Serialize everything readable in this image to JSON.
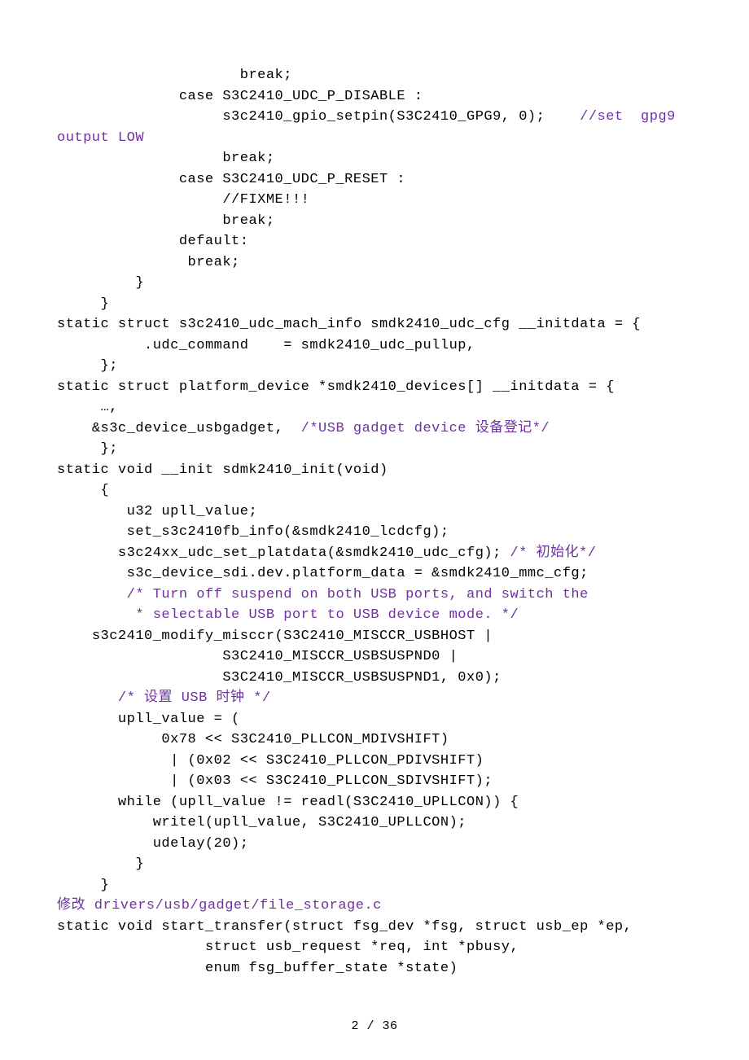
{
  "lines": [
    {
      "indent": "                     ",
      "spans": [
        {
          "t": "break;",
          "c": "black"
        }
      ]
    },
    {
      "indent": "              ",
      "spans": [
        {
          "t": "case S3C2410_UDC_P_DISABLE :",
          "c": "black"
        }
      ]
    },
    {
      "indent": "                   ",
      "spans": [
        {
          "t": "s3c2410_gpio_setpin(S3C2410_GPG9, 0);    ",
          "c": "black"
        },
        {
          "t": "//set  gpg9",
          "c": "purple"
        }
      ]
    },
    {
      "indent": "",
      "spans": [
        {
          "t": "output LOW",
          "c": "purple"
        }
      ]
    },
    {
      "indent": "                   ",
      "spans": [
        {
          "t": "break;",
          "c": "black"
        }
      ]
    },
    {
      "indent": "              ",
      "spans": [
        {
          "t": "case S3C2410_UDC_P_RESET :",
          "c": "black"
        }
      ]
    },
    {
      "indent": "                   ",
      "spans": [
        {
          "t": "//FIXME!!!",
          "c": "black"
        }
      ]
    },
    {
      "indent": "                   ",
      "spans": [
        {
          "t": "break;",
          "c": "black"
        }
      ]
    },
    {
      "indent": "              ",
      "spans": [
        {
          "t": "default:",
          "c": "black"
        }
      ]
    },
    {
      "indent": "               ",
      "spans": [
        {
          "t": "break;",
          "c": "black"
        }
      ]
    },
    {
      "indent": "         ",
      "spans": [
        {
          "t": "}",
          "c": "black"
        }
      ]
    },
    {
      "indent": "     ",
      "spans": [
        {
          "t": "}",
          "c": "black"
        }
      ]
    },
    {
      "indent": "",
      "spans": [
        {
          "t": "static struct s3c2410_udc_mach_info smdk2410_udc_cfg __initdata = {",
          "c": "black"
        }
      ]
    },
    {
      "indent": "          ",
      "spans": [
        {
          "t": ".udc_command    = smdk2410_udc_pullup,",
          "c": "black"
        }
      ]
    },
    {
      "indent": "     ",
      "spans": [
        {
          "t": "};",
          "c": "black"
        }
      ]
    },
    {
      "indent": "",
      "spans": [
        {
          "t": "static struct platform_device *smdk2410_devices[] __initdata = {",
          "c": "black"
        }
      ]
    },
    {
      "indent": "     ",
      "spans": [
        {
          "t": "…,",
          "c": "black"
        }
      ]
    },
    {
      "indent": "    ",
      "spans": [
        {
          "t": "&s3c_device_usbgadget,  ",
          "c": "black"
        },
        {
          "t": "/*USB gadget device 设备登记*/",
          "c": "purple"
        }
      ]
    },
    {
      "indent": "     ",
      "spans": [
        {
          "t": "};",
          "c": "black"
        }
      ]
    },
    {
      "indent": "",
      "spans": [
        {
          "t": "static void __init sdmk2410_init(void)",
          "c": "black"
        }
      ]
    },
    {
      "indent": "     ",
      "spans": [
        {
          "t": "{",
          "c": "black"
        }
      ]
    },
    {
      "indent": "        ",
      "spans": [
        {
          "t": "u32 upll_value;",
          "c": "black"
        }
      ]
    },
    {
      "indent": "        ",
      "spans": [
        {
          "t": "set_s3c2410fb_info(&smdk2410_lcdcfg);",
          "c": "black"
        }
      ]
    },
    {
      "indent": "       ",
      "spans": [
        {
          "t": "s3c24xx_udc_set_platdata(&smdk2410_udc_cfg); ",
          "c": "black"
        },
        {
          "t": "/* 初始化*/",
          "c": "purple"
        }
      ]
    },
    {
      "indent": "        ",
      "spans": [
        {
          "t": "s3c_device_sdi.dev.platform_data = &smdk2410_mmc_cfg;",
          "c": "black"
        }
      ]
    },
    {
      "indent": "        ",
      "spans": [
        {
          "t": "/* Turn off suspend on both USB ports, and switch the",
          "c": "purple"
        }
      ]
    },
    {
      "indent": "         ",
      "spans": [
        {
          "t": "* selectable USB port to USB device mode. */",
          "c": "purple"
        }
      ]
    },
    {
      "indent": "    ",
      "spans": [
        {
          "t": "s3c2410_modify_misccr(S3C2410_MISCCR_USBHOST |",
          "c": "black"
        }
      ]
    },
    {
      "indent": "                   ",
      "spans": [
        {
          "t": "S3C2410_MISCCR_USBSUSPND0 |",
          "c": "black"
        }
      ]
    },
    {
      "indent": "                   ",
      "spans": [
        {
          "t": "S3C2410_MISCCR_USBSUSPND1, 0x0);",
          "c": "black"
        }
      ]
    },
    {
      "indent": "       ",
      "spans": [
        {
          "t": "/* 设置 USB 时钟 */",
          "c": "purple"
        }
      ]
    },
    {
      "indent": "       ",
      "spans": [
        {
          "t": "upll_value = (",
          "c": "black"
        }
      ]
    },
    {
      "indent": "            ",
      "spans": [
        {
          "t": "0x78 << S3C2410_PLLCON_MDIVSHIFT)",
          "c": "black"
        }
      ]
    },
    {
      "indent": "             ",
      "spans": [
        {
          "t": "| (0x02 << S3C2410_PLLCON_PDIVSHIFT)",
          "c": "black"
        }
      ]
    },
    {
      "indent": "             ",
      "spans": [
        {
          "t": "| (0x03 << S3C2410_PLLCON_SDIVSHIFT);",
          "c": "black"
        }
      ]
    },
    {
      "indent": "       ",
      "spans": [
        {
          "t": "while (upll_value != readl(S3C2410_UPLLCON)) {",
          "c": "black"
        }
      ]
    },
    {
      "indent": "           ",
      "spans": [
        {
          "t": "writel(upll_value, S3C2410_UPLLCON);",
          "c": "black"
        }
      ]
    },
    {
      "indent": "           ",
      "spans": [
        {
          "t": "udelay(20);",
          "c": "black"
        }
      ]
    },
    {
      "indent": "         ",
      "spans": [
        {
          "t": "}",
          "c": "black"
        }
      ]
    },
    {
      "indent": "     ",
      "spans": [
        {
          "t": "}",
          "c": "black"
        }
      ]
    },
    {
      "indent": "",
      "spans": [
        {
          "t": "修改 drivers/usb/gadget/file_storage.c",
          "c": "purple"
        }
      ]
    },
    {
      "indent": "",
      "spans": [
        {
          "t": "static void start_transfer(struct fsg_dev *fsg, struct usb_ep *ep,",
          "c": "black"
        }
      ]
    },
    {
      "indent": "                 ",
      "spans": [
        {
          "t": "struct usb_request *req, int *pbusy,",
          "c": "black"
        }
      ]
    },
    {
      "indent": "                 ",
      "spans": [
        {
          "t": "enum fsg_buffer_state *state)",
          "c": "black"
        }
      ]
    }
  ],
  "footer": "2 / 36"
}
